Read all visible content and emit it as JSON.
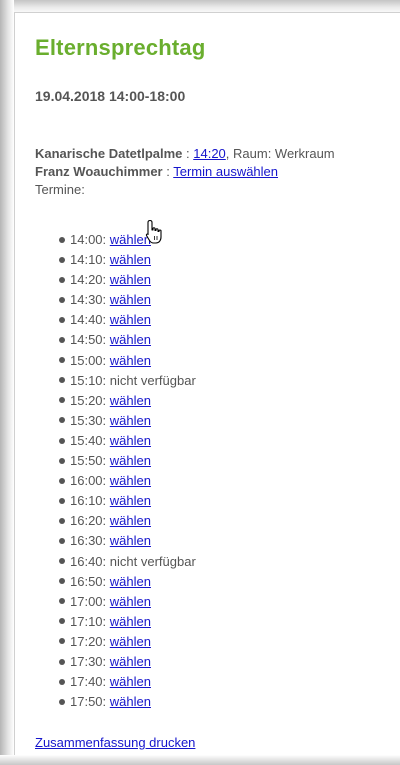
{
  "header": {
    "title": "Elternsprechtag",
    "date": "19.04.2018 14:00-18:00"
  },
  "appointment": {
    "student1_name": "Kanarische Datetlpalme",
    "student1_time": "14:20",
    "student1_room": ", Raum: Werkraum",
    "student2_name": "Franz Woauchimmer",
    "student2_action": "Termin auswählen",
    "separator": " : ",
    "termine_label": "Termine:"
  },
  "slots": [
    {
      "time": "14:00:",
      "label": "wählen",
      "available": true
    },
    {
      "time": "14:10:",
      "label": "wählen",
      "available": true
    },
    {
      "time": "14:20:",
      "label": "wählen",
      "available": true
    },
    {
      "time": "14:30:",
      "label": "wählen",
      "available": true
    },
    {
      "time": "14:40:",
      "label": "wählen",
      "available": true
    },
    {
      "time": "14:50:",
      "label": "wählen",
      "available": true
    },
    {
      "time": "15:00:",
      "label": "wählen",
      "available": true
    },
    {
      "time": "15:10:",
      "label": "nicht verfügbar",
      "available": false
    },
    {
      "time": "15:20:",
      "label": "wählen",
      "available": true
    },
    {
      "time": "15:30:",
      "label": "wählen",
      "available": true
    },
    {
      "time": "15:40:",
      "label": "wählen",
      "available": true
    },
    {
      "time": "15:50:",
      "label": "wählen",
      "available": true
    },
    {
      "time": "16:00:",
      "label": "wählen",
      "available": true
    },
    {
      "time": "16:10:",
      "label": "wählen",
      "available": true
    },
    {
      "time": "16:20:",
      "label": "wählen",
      "available": true
    },
    {
      "time": "16:30:",
      "label": "wählen",
      "available": true
    },
    {
      "time": "16:40:",
      "label": "nicht verfügbar",
      "available": false
    },
    {
      "time": "16:50:",
      "label": "wählen",
      "available": true
    },
    {
      "time": "17:00:",
      "label": "wählen",
      "available": true
    },
    {
      "time": "17:10:",
      "label": "wählen",
      "available": true
    },
    {
      "time": "17:20:",
      "label": "wählen",
      "available": true
    },
    {
      "time": "17:30:",
      "label": "wählen",
      "available": true
    },
    {
      "time": "17:40:",
      "label": "wählen",
      "available": true
    },
    {
      "time": "17:50:",
      "label": "wählen",
      "available": true
    }
  ],
  "footer": {
    "summary_link": "Zusammenfassung drucken"
  },
  "colors": {
    "title": "#6aae2e",
    "link": "#1515cc",
    "text": "#555555"
  },
  "icons": {
    "cursor": "hand-pointer-icon"
  }
}
